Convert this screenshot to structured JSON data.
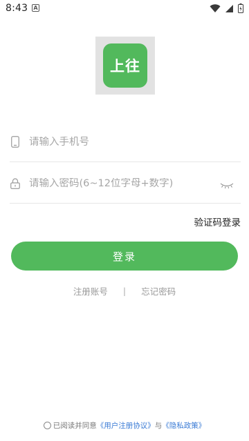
{
  "status_bar": {
    "time": "8:43",
    "notification_icon": "A"
  },
  "logo": {
    "text": "上往",
    "color": "#52b95c"
  },
  "form": {
    "phone_placeholder": "请输入手机号",
    "password_placeholder": "请输入密码(6~12位字母+数字)",
    "code_login_label": "验证码登录",
    "login_button": "登录"
  },
  "links": {
    "register": "注册账号",
    "separator": "|",
    "forgot": "忘记密码"
  },
  "agreement": {
    "prefix": "已阅读并同意",
    "user_agreement": "《用户注册协议》",
    "conjunction": "与",
    "privacy_policy": "《隐私政策》",
    "link_color": "#3a7bd5"
  },
  "icons": {
    "phone": "phone-icon",
    "lock": "lock-icon",
    "eye": "eye-closed-icon",
    "wifi": "wifi-icon",
    "signal": "signal-icon",
    "battery": "battery-icon"
  }
}
